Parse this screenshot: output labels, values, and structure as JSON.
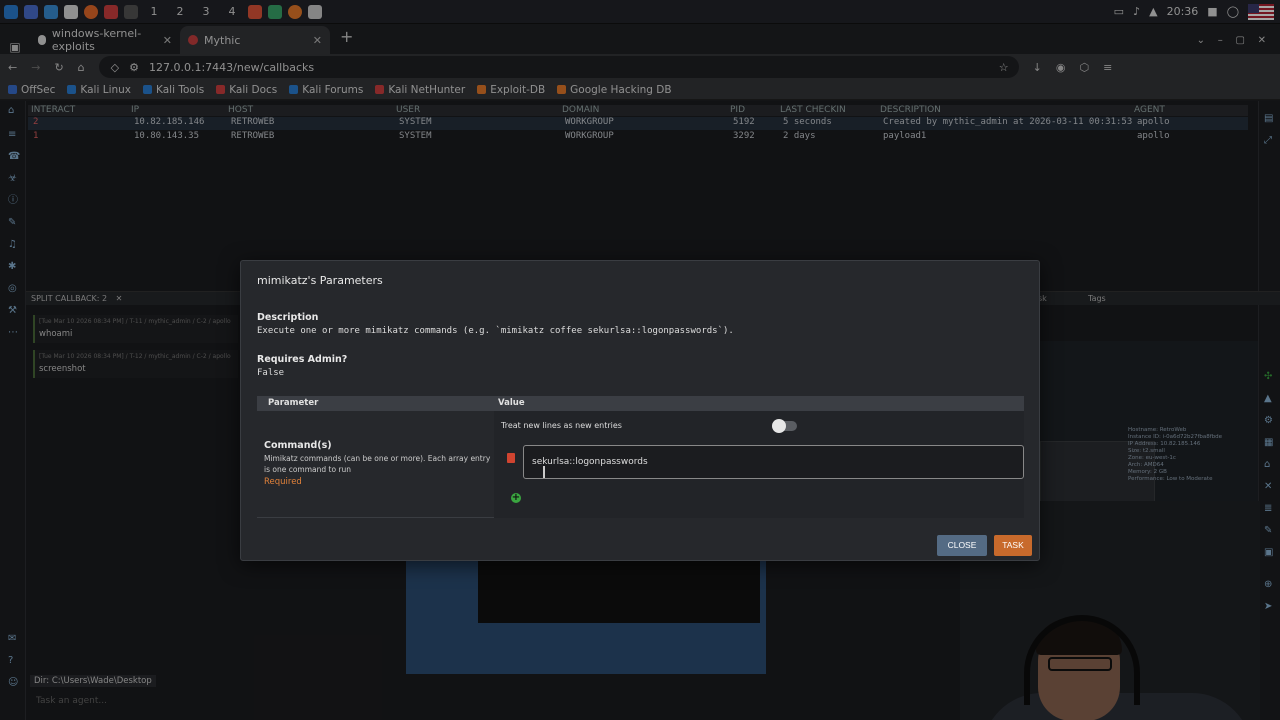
{
  "taskbar": {
    "workspaces": [
      "1",
      "2",
      "3",
      "4"
    ],
    "clock": "20:36"
  },
  "browser": {
    "tabs": [
      {
        "title": "windows-kernel-exploits"
      },
      {
        "title": "Mythic"
      }
    ],
    "url": "127.0.0.1:7443/new/callbacks",
    "bookmarks": [
      "OffSec",
      "Kali Linux",
      "Kali Tools",
      "Kali Docs",
      "Kali Forums",
      "Kali NetHunter",
      "Exploit-DB",
      "Google Hacking DB"
    ]
  },
  "callbacks": {
    "headers": [
      "INTERACT",
      "IP",
      "HOST",
      "USER",
      "DOMAIN",
      "PID",
      "LAST CHECKIN",
      "DESCRIPTION",
      "AGENT"
    ],
    "rows": [
      {
        "id": "2",
        "ip": "10.82.185.146",
        "host": "RETROWEB",
        "user": "SYSTEM",
        "domain": "WORKGROUP",
        "pid": "5192",
        "checkin": "5 seconds",
        "desc": "Created by mythic_admin at 2026-03-11 00:31:53",
        "agent": "apollo"
      },
      {
        "id": "1",
        "ip": "10.80.143.35",
        "host": "RETROWEB",
        "user": "SYSTEM",
        "domain": "WORKGROUP",
        "pid": "3292",
        "checkin": "2 days",
        "desc": "payload1",
        "agent": "apollo"
      }
    ]
  },
  "split": {
    "title": "SPLIT CALLBACK: 2",
    "tasks": [
      {
        "meta": "[Tue Mar 10 2026 08:34 PM] / T-11 / mythic_admin / C-2 / apollo",
        "cmd": "whoami"
      },
      {
        "meta": "[Tue Mar 10 2026 08:34 PM] / T-12 / mythic_admin / C-2 / apollo",
        "cmd": "screenshot"
      }
    ],
    "dir": "Dir: C:\\Users\\Wade\\Desktop",
    "agent_placeholder": "Task an agent...",
    "tags_label": "Tags",
    "task_label": "sk"
  },
  "modal": {
    "title": "mimikatz's Parameters",
    "desc_label": "Description",
    "desc": "Execute one or more mimikatz commands (e.g. `mimikatz coffee sekurlsa::logonpasswords`).",
    "admin_label": "Requires Admin?",
    "admin_value": "False",
    "col_param": "Parameter",
    "col_value": "Value",
    "param_name": "Command(s)",
    "param_desc": "Mimikatz commands (can be one or more). Each array entry is one command to run",
    "param_required": "Required",
    "toggle_label": "Treat new lines as new entries",
    "command_value": "sekurlsa::logonpasswords",
    "close_label": "CLOSE",
    "task_label": "TASK"
  },
  "bg_info": [
    "Hostname: RetroWeb",
    "Instance ID: i-0a6d72b27fba8fbde",
    "IP Address: 10.82.185.146",
    "Size: t2.small",
    "Zone: eu-west-1c",
    "Arch: AMD64",
    "Memory: 2 GB",
    "Performance: Low to Moderate"
  ],
  "colors": {
    "accent": "#c86a2c",
    "close": "#546b84",
    "required": "#e0813a"
  }
}
